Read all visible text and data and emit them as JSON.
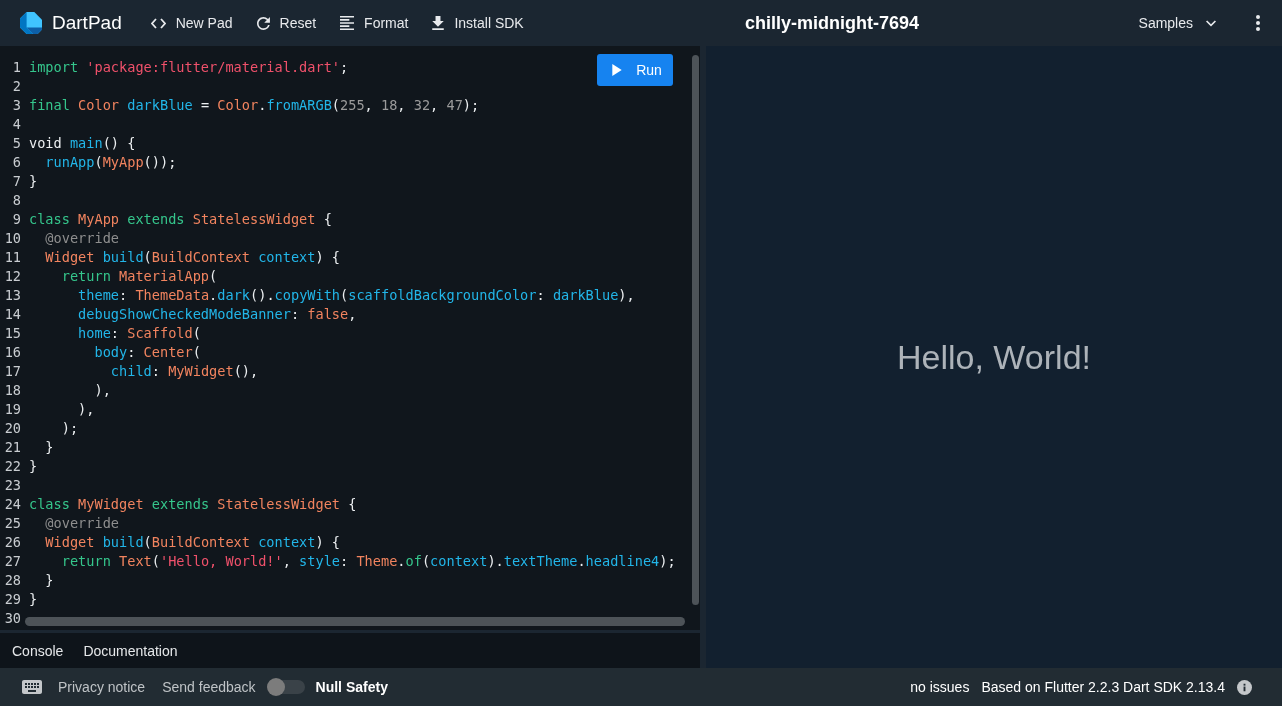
{
  "top_bar": {
    "logo": "DartPad",
    "actions": [
      {
        "kind": "new",
        "label": "New Pad"
      },
      {
        "kind": "reset",
        "label": "Reset"
      },
      {
        "kind": "format",
        "label": "Format"
      },
      {
        "kind": "install",
        "label": "Install SDK"
      }
    ],
    "title": "chilly-midnight-7694",
    "samples": "Samples"
  },
  "editor": {
    "run_button": "Run",
    "lines": [
      {
        "number": "1",
        "tokens": [
          {
            "kind": "keyword",
            "text": "import "
          },
          {
            "kind": "string",
            "text": "'package:flutter/material.dart'"
          },
          {
            "kind": "plain",
            "text": ";"
          }
        ]
      },
      {
        "number": "2"
      },
      {
        "number": "3",
        "tokens": [
          {
            "kind": "keyword",
            "text": "final "
          },
          {
            "kind": "type",
            "text": "Color "
          },
          {
            "kind": "name",
            "text": "darkBlue"
          },
          {
            "kind": "plain",
            "text": " = "
          },
          {
            "kind": "type",
            "text": "Color"
          },
          {
            "kind": "plain",
            "text": "."
          },
          {
            "kind": "name",
            "text": "fromARGB"
          },
          {
            "kind": "plain",
            "text": "("
          },
          {
            "kind": "number",
            "text": "255"
          },
          {
            "kind": "plain",
            "text": ", "
          },
          {
            "kind": "number",
            "text": "18"
          },
          {
            "kind": "plain",
            "text": ", "
          },
          {
            "kind": "number",
            "text": "32"
          },
          {
            "kind": "plain",
            "text": ", "
          },
          {
            "kind": "number",
            "text": "47"
          },
          {
            "kind": "plain",
            "text": ");"
          }
        ]
      },
      {
        "number": "4"
      },
      {
        "number": "5",
        "tokens": [
          {
            "kind": "plain",
            "text": "void "
          },
          {
            "kind": "name",
            "text": "main"
          },
          {
            "kind": "plain",
            "text": "() {"
          }
        ]
      },
      {
        "number": "6",
        "tokens": [
          {
            "kind": "name",
            "text": "  runApp"
          },
          {
            "kind": "plain",
            "text": "("
          },
          {
            "kind": "type",
            "text": "MyApp"
          },
          {
            "kind": "plain",
            "text": "());"
          }
        ]
      },
      {
        "number": "7",
        "tokens": [
          {
            "kind": "plain",
            "text": "}"
          }
        ]
      },
      {
        "number": "8"
      },
      {
        "number": "9",
        "tokens": [
          {
            "kind": "keyword",
            "text": "class "
          },
          {
            "kind": "type",
            "text": "MyApp "
          },
          {
            "kind": "keyword",
            "text": "extends "
          },
          {
            "kind": "type",
            "text": "StatelessWidget "
          },
          {
            "kind": "plain",
            "text": "{"
          }
        ]
      },
      {
        "number": "10",
        "tokens": [
          {
            "kind": "annotation",
            "text": "  @override"
          }
        ]
      },
      {
        "number": "11",
        "tokens": [
          {
            "kind": "type",
            "text": "  Widget "
          },
          {
            "kind": "name",
            "text": "build"
          },
          {
            "kind": "plain",
            "text": "("
          },
          {
            "kind": "type",
            "text": "BuildContext "
          },
          {
            "kind": "name",
            "text": "context"
          },
          {
            "kind": "plain",
            "text": ") {"
          }
        ]
      },
      {
        "number": "12",
        "tokens": [
          {
            "kind": "keyword",
            "text": "    return "
          },
          {
            "kind": "type",
            "text": "MaterialApp"
          },
          {
            "kind": "plain",
            "text": "("
          }
        ]
      },
      {
        "number": "13",
        "tokens": [
          {
            "kind": "name",
            "text": "      theme"
          },
          {
            "kind": "plain",
            "text": ": "
          },
          {
            "kind": "type",
            "text": "ThemeData"
          },
          {
            "kind": "plain",
            "text": "."
          },
          {
            "kind": "name",
            "text": "dark"
          },
          {
            "kind": "plain",
            "text": "()."
          },
          {
            "kind": "name",
            "text": "copyWith"
          },
          {
            "kind": "plain",
            "text": "("
          },
          {
            "kind": "name",
            "text": "scaffoldBackgroundColor"
          },
          {
            "kind": "plain",
            "text": ": "
          },
          {
            "kind": "name",
            "text": "darkBlue"
          },
          {
            "kind": "plain",
            "text": "),"
          }
        ]
      },
      {
        "number": "14",
        "tokens": [
          {
            "kind": "name",
            "text": "      debugShowCheckedModeBanner"
          },
          {
            "kind": "plain",
            "text": ": "
          },
          {
            "kind": "type",
            "text": "false"
          },
          {
            "kind": "plain",
            "text": ","
          }
        ]
      },
      {
        "number": "15",
        "tokens": [
          {
            "kind": "name",
            "text": "      home"
          },
          {
            "kind": "plain",
            "text": ": "
          },
          {
            "kind": "type",
            "text": "Scaffold"
          },
          {
            "kind": "plain",
            "text": "("
          }
        ]
      },
      {
        "number": "16",
        "tokens": [
          {
            "kind": "name",
            "text": "        body"
          },
          {
            "kind": "plain",
            "text": ": "
          },
          {
            "kind": "type",
            "text": "Center"
          },
          {
            "kind": "plain",
            "text": "("
          }
        ]
      },
      {
        "number": "17",
        "tokens": [
          {
            "kind": "name",
            "text": "          child"
          },
          {
            "kind": "plain",
            "text": ": "
          },
          {
            "kind": "type",
            "text": "MyWidget"
          },
          {
            "kind": "plain",
            "text": "(),"
          }
        ]
      },
      {
        "number": "18",
        "tokens": [
          {
            "kind": "plain",
            "text": "        ),"
          }
        ]
      },
      {
        "number": "19",
        "tokens": [
          {
            "kind": "plain",
            "text": "      ),"
          }
        ]
      },
      {
        "number": "20",
        "tokens": [
          {
            "kind": "plain",
            "text": "    );"
          }
        ]
      },
      {
        "number": "21",
        "tokens": [
          {
            "kind": "plain",
            "text": "  }"
          }
        ]
      },
      {
        "number": "22",
        "tokens": [
          {
            "kind": "plain",
            "text": "}"
          }
        ]
      },
      {
        "number": "23"
      },
      {
        "number": "24",
        "tokens": [
          {
            "kind": "keyword",
            "text": "class "
          },
          {
            "kind": "type",
            "text": "MyWidget "
          },
          {
            "kind": "keyword",
            "text": "extends "
          },
          {
            "kind": "type",
            "text": "StatelessWidget "
          },
          {
            "kind": "plain",
            "text": "{"
          }
        ]
      },
      {
        "number": "25",
        "tokens": [
          {
            "kind": "annotation",
            "text": "  @override"
          }
        ]
      },
      {
        "number": "26",
        "tokens": [
          {
            "kind": "type",
            "text": "  Widget "
          },
          {
            "kind": "name",
            "text": "build"
          },
          {
            "kind": "plain",
            "text": "("
          },
          {
            "kind": "type",
            "text": "BuildContext "
          },
          {
            "kind": "name",
            "text": "context"
          },
          {
            "kind": "plain",
            "text": ") {"
          }
        ]
      },
      {
        "number": "27",
        "tokens": [
          {
            "kind": "keyword",
            "text": "    return "
          },
          {
            "kind": "type",
            "text": "Text"
          },
          {
            "kind": "plain",
            "text": "("
          },
          {
            "kind": "string",
            "text": "'Hello, World!'"
          },
          {
            "kind": "plain",
            "text": ", "
          },
          {
            "kind": "name",
            "text": "style"
          },
          {
            "kind": "plain",
            "text": ": "
          },
          {
            "kind": "type",
            "text": "Theme"
          },
          {
            "kind": "plain",
            "text": "."
          },
          {
            "kind": "keyword",
            "text": "of"
          },
          {
            "kind": "plain",
            "text": "("
          },
          {
            "kind": "name",
            "text": "context"
          },
          {
            "kind": "plain",
            "text": ")."
          },
          {
            "kind": "name",
            "text": "textTheme"
          },
          {
            "kind": "plain",
            "text": "."
          },
          {
            "kind": "name",
            "text": "headline4"
          },
          {
            "kind": "plain",
            "text": ");"
          }
        ]
      },
      {
        "number": "28",
        "tokens": [
          {
            "kind": "plain",
            "text": "  }"
          }
        ]
      },
      {
        "number": "29",
        "tokens": [
          {
            "kind": "plain",
            "text": "}"
          }
        ]
      },
      {
        "number": "30"
      }
    ]
  },
  "bottom_tabs": [
    {
      "label": "Console"
    },
    {
      "label": "Documentation"
    }
  ],
  "output": {
    "text": "Hello, World!"
  },
  "status_bar": {
    "links": [
      {
        "label": "Privacy notice"
      },
      {
        "label": "Send feedback"
      }
    ],
    "null_safety": {
      "label": "Null Safety",
      "on": false
    },
    "issues": "no issues",
    "version": "Based on Flutter 2.2.3 Dart SDK 2.13.4"
  }
}
